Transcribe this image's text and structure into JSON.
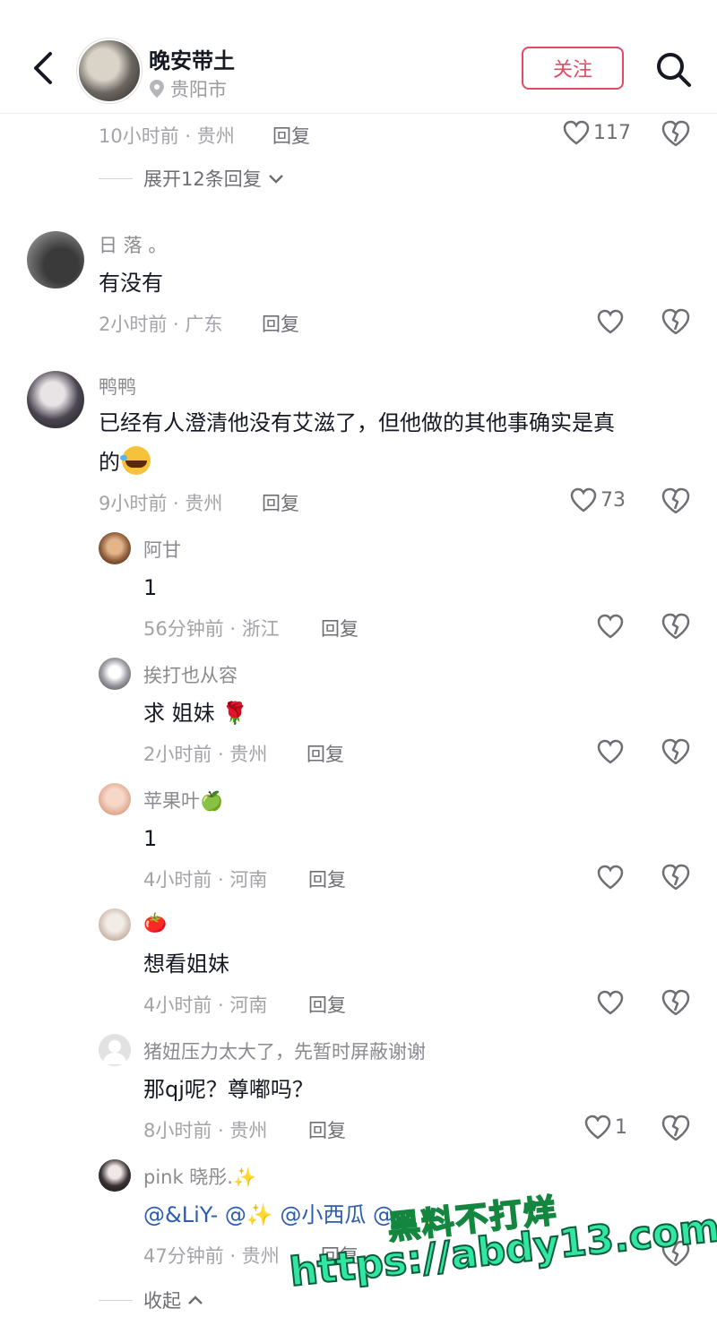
{
  "header": {
    "back_icon": "chevron-left-icon",
    "username": "晚安带土",
    "location": "贵阳市",
    "follow_label": "关注",
    "search_icon": "search-icon",
    "accent": "#e34a63"
  },
  "top_comment_tail": {
    "meta": "10小时前 · 贵州",
    "reply_label": "回复",
    "likes": "117",
    "expand_label": "展开12条回复"
  },
  "comments": [
    {
      "user": "日 落 。",
      "text": "有没有",
      "meta": "2小时前 · 广东",
      "reply_label": "回复",
      "likes": ""
    },
    {
      "user": "鸭鸭",
      "text_line1": "已经有人澄清他没有艾滋了，但他做的其他事确实是真",
      "text_line2": "的",
      "meta": "9小时前 · 贵州",
      "reply_label": "回复",
      "likes": "73",
      "replies": [
        {
          "user": "阿甘",
          "text": "1",
          "meta": "56分钟前 · 浙江",
          "reply_label": "回复",
          "likes": ""
        },
        {
          "user": "挨打也从容",
          "text": "求 姐妹 🌹",
          "meta": "2小时前 · 贵州",
          "reply_label": "回复",
          "likes": ""
        },
        {
          "user": "苹果叶🍏",
          "text": "1",
          "meta": "4小时前 · 河南",
          "reply_label": "回复",
          "likes": ""
        },
        {
          "user": "🍅",
          "text": "想看姐妹",
          "meta": "4小时前 · 河南",
          "reply_label": "回复",
          "likes": ""
        },
        {
          "user": "猪妞压力太大了，先暂时屏蔽谢谢",
          "text": "那qj呢？尊嘟吗？",
          "meta": "8小时前 · 贵州",
          "reply_label": "回复",
          "likes": "1"
        },
        {
          "user": "pink 晓彤.✨",
          "text": "@&LiY- @✨ @小西瓜 @",
          "meta": "47分钟前 · 贵州",
          "reply_label": "回复",
          "likes": ""
        }
      ]
    }
  ],
  "collapse_label": "收起",
  "watermark": {
    "line1": "黑料不打烊",
    "line2": "https://abdy13.com"
  }
}
